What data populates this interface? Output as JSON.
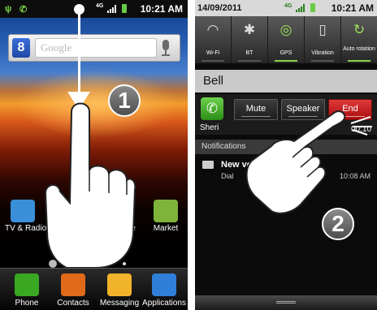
{
  "left_screen": {
    "status_bar": {
      "time": "10:21 AM",
      "network_label": "4G"
    },
    "search": {
      "logo": "8",
      "placeholder": "Google"
    },
    "step_number": "1",
    "home_apps": [
      {
        "label": "TV & Radio",
        "color": "#3a8fd8"
      },
      {
        "label": "rve",
        "color": "#5a5a5a"
      },
      {
        "label": "Market",
        "color": "#7fb33a"
      }
    ],
    "dock": [
      {
        "label": "Phone",
        "icon": "phone-icon",
        "color": "#3aa823"
      },
      {
        "label": "Contacts",
        "icon": "contacts-icon",
        "color": "#e06a1a"
      },
      {
        "label": "Messaging",
        "icon": "envelope-icon",
        "color": "#f1b32a"
      },
      {
        "label": "Applications",
        "icon": "grid-icon",
        "color": "#2f7fd8"
      }
    ]
  },
  "right_screen": {
    "status_bar": {
      "date": "14/09/2011",
      "time": "10:21 AM",
      "network_label": "4G"
    },
    "quick_toggles": [
      {
        "label": "Wi-Fi",
        "icon": "wifi-icon",
        "glyph": "◠",
        "on": false
      },
      {
        "label": "BT",
        "icon": "bluetooth-icon",
        "glyph": "✱",
        "on": false
      },
      {
        "label": "GPS",
        "icon": "gps-icon",
        "glyph": "◎",
        "on": true
      },
      {
        "label": "Vibration",
        "icon": "vibration-icon",
        "glyph": "▯",
        "on": false
      },
      {
        "label": "Auto rotation",
        "icon": "rotation-icon",
        "glyph": "↻",
        "on": true
      }
    ],
    "call": {
      "caller": "Bell",
      "contact_name": "Sheri",
      "duration": "00:10",
      "buttons": {
        "mute": "Mute",
        "speaker": "Speaker",
        "end": "End"
      }
    },
    "notifications_header": "Notifications",
    "notification": {
      "title": "New voic",
      "subtitle": "Dial",
      "time": "10:08 AM"
    },
    "step_number": "2"
  }
}
